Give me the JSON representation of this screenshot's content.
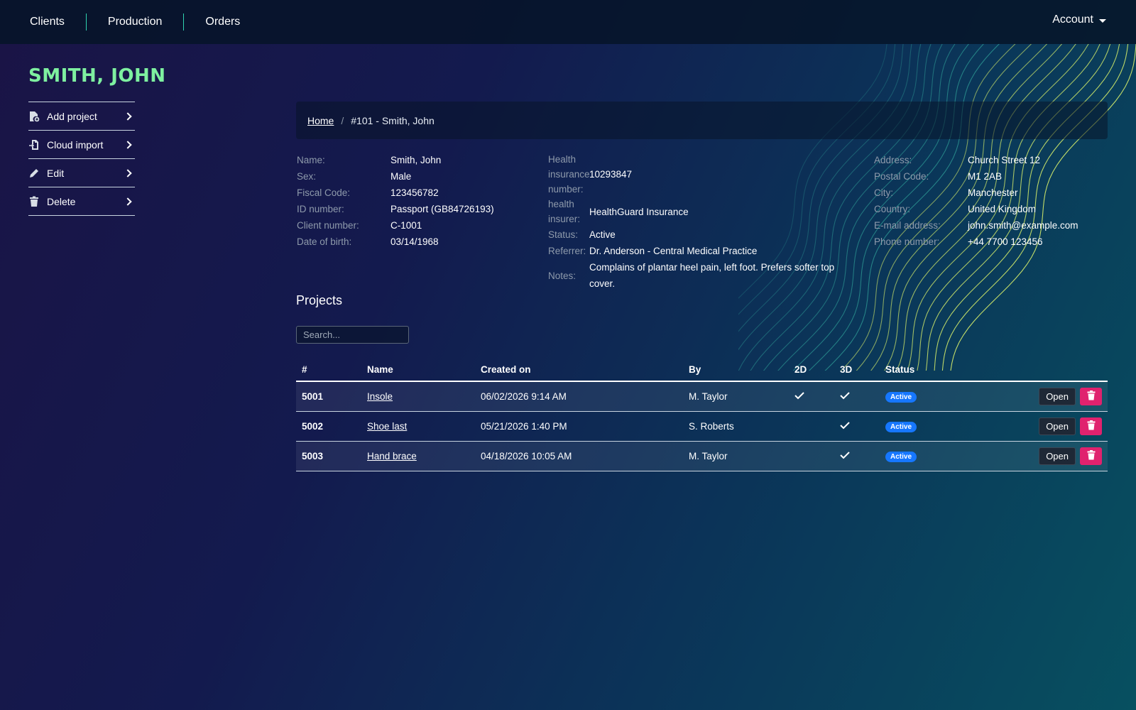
{
  "nav": {
    "items": [
      "Clients",
      "Production",
      "Orders"
    ],
    "account_label": "Account"
  },
  "client": {
    "title": "SMITH, JOHN"
  },
  "sidebar": {
    "items": [
      {
        "label": "Add project",
        "icon": "file-add-icon"
      },
      {
        "label": "Cloud import",
        "icon": "cloud-import-icon"
      },
      {
        "label": "Edit",
        "icon": "pencil-icon"
      },
      {
        "label": "Delete",
        "icon": "trash-icon"
      }
    ]
  },
  "breadcrumb": {
    "home": "Home",
    "current": "#101 - Smith, John"
  },
  "info": {
    "col1": [
      {
        "label": "Name:",
        "value": "Smith, John"
      },
      {
        "label": "Sex:",
        "value": "Male"
      },
      {
        "label": "Fiscal Code:",
        "value": "123456782"
      },
      {
        "label": "ID number:",
        "value": "Passport (GB84726193)"
      },
      {
        "label": "Client number:",
        "value": "C-1001"
      },
      {
        "label": "Date of birth:",
        "value": "03/14/1968"
      }
    ],
    "col2": [
      {
        "label": "Health insurance number:",
        "value": "10293847"
      },
      {
        "label": "health insurer:",
        "value": "HealthGuard Insurance"
      },
      {
        "label": "Status:",
        "value": "Active"
      },
      {
        "label": "Referrer:",
        "value": "Dr. Anderson - Central Medical Practice"
      },
      {
        "label": "Notes:",
        "value": "Complains of plantar heel pain, left foot. Prefers softer top cover."
      }
    ],
    "col3": [
      {
        "label": "Address:",
        "value": "Church Street 12"
      },
      {
        "label": "Postal Code:",
        "value": "M1 2AB"
      },
      {
        "label": "City:",
        "value": "Manchester"
      },
      {
        "label": "Country:",
        "value": "United Kingdom"
      },
      {
        "label": "E-mail address:",
        "value": "john.smith@example.com"
      },
      {
        "label": "Phone number:",
        "value": "+44 7700 123456"
      }
    ]
  },
  "projects": {
    "title": "Projects",
    "search_placeholder": "Search...",
    "columns": [
      "#",
      "Name",
      "Created on",
      "By",
      "2D",
      "3D",
      "Status"
    ],
    "open_label": "Open",
    "rows": [
      {
        "num": "5001",
        "name": "Insole",
        "created": "06/02/2026 9:14 AM",
        "by": "M. Taylor",
        "d2": true,
        "d3": true,
        "status": "Active"
      },
      {
        "num": "5002",
        "name": "Shoe last",
        "created": "05/21/2026 1:40 PM",
        "by": "S. Roberts",
        "d2": false,
        "d3": true,
        "status": "Active"
      },
      {
        "num": "5003",
        "name": "Hand brace",
        "created": "04/18/2026 10:05 AM",
        "by": "M. Taylor",
        "d2": false,
        "d3": true,
        "status": "Active"
      }
    ]
  },
  "colors": {
    "accent_green": "#7ef0a0",
    "nav_separator": "#2fd3b0",
    "badge_blue": "#1677ff",
    "delete_pink": "#e0226e"
  }
}
